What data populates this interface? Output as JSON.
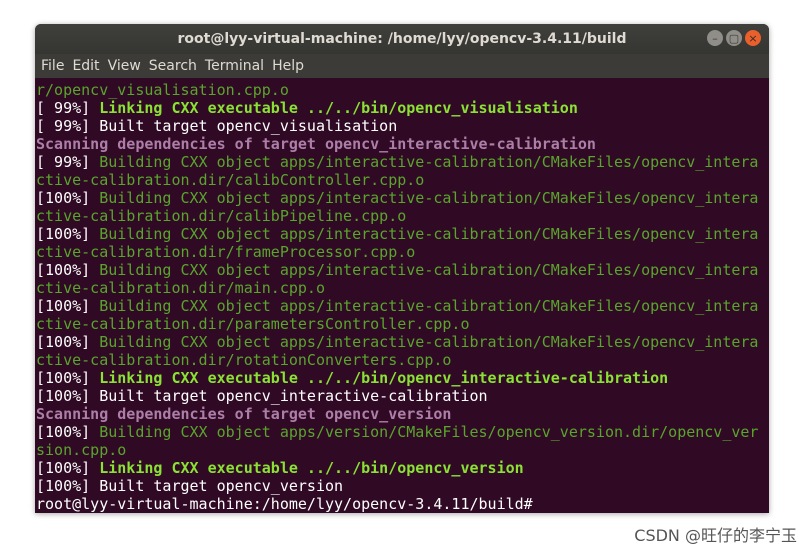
{
  "window": {
    "title": "root@lyy-virtual-machine: /home/lyy/opencv-3.4.11/build",
    "buttons": {
      "minimize": "–",
      "maximize": "▢",
      "close": "×"
    }
  },
  "menu": [
    "File",
    "Edit",
    "View",
    "Search",
    "Terminal",
    "Help"
  ],
  "terminal": {
    "lines": [
      {
        "prefix": "",
        "text": "r/opencv_visualisation.cpp.o",
        "style": "green"
      },
      {
        "prefix": "[ 99%] ",
        "text": "Linking CXX executable ../../bin/opencv_visualisation",
        "style": "bold-green"
      },
      {
        "prefix": "[ 99%] ",
        "text": "Built target opencv_visualisation",
        "style": "white"
      },
      {
        "prefix": "",
        "text": "Scanning dependencies of target opencv_interactive-calibration",
        "style": "magenta"
      },
      {
        "prefix": "[ 99%] ",
        "text": "Building CXX object apps/interactive-calibration/CMakeFiles/opencv_intera",
        "style": "green"
      },
      {
        "prefix": "",
        "text": "ctive-calibration.dir/calibController.cpp.o",
        "style": "green"
      },
      {
        "prefix": "[100%] ",
        "text": "Building CXX object apps/interactive-calibration/CMakeFiles/opencv_intera",
        "style": "green"
      },
      {
        "prefix": "",
        "text": "ctive-calibration.dir/calibPipeline.cpp.o",
        "style": "green"
      },
      {
        "prefix": "[100%] ",
        "text": "Building CXX object apps/interactive-calibration/CMakeFiles/opencv_intera",
        "style": "green"
      },
      {
        "prefix": "",
        "text": "ctive-calibration.dir/frameProcessor.cpp.o",
        "style": "green"
      },
      {
        "prefix": "[100%] ",
        "text": "Building CXX object apps/interactive-calibration/CMakeFiles/opencv_intera",
        "style": "green"
      },
      {
        "prefix": "",
        "text": "ctive-calibration.dir/main.cpp.o",
        "style": "green"
      },
      {
        "prefix": "[100%] ",
        "text": "Building CXX object apps/interactive-calibration/CMakeFiles/opencv_intera",
        "style": "green"
      },
      {
        "prefix": "",
        "text": "ctive-calibration.dir/parametersController.cpp.o",
        "style": "green"
      },
      {
        "prefix": "[100%] ",
        "text": "Building CXX object apps/interactive-calibration/CMakeFiles/opencv_intera",
        "style": "green"
      },
      {
        "prefix": "",
        "text": "ctive-calibration.dir/rotationConverters.cpp.o",
        "style": "green"
      },
      {
        "prefix": "[100%] ",
        "text": "Linking CXX executable ../../bin/opencv_interactive-calibration",
        "style": "bold-green"
      },
      {
        "prefix": "[100%] ",
        "text": "Built target opencv_interactive-calibration",
        "style": "white"
      },
      {
        "prefix": "",
        "text": "Scanning dependencies of target opencv_version",
        "style": "magenta"
      },
      {
        "prefix": "[100%] ",
        "text": "Building CXX object apps/version/CMakeFiles/opencv_version.dir/opencv_ver",
        "style": "green"
      },
      {
        "prefix": "",
        "text": "sion.cpp.o",
        "style": "green"
      },
      {
        "prefix": "[100%] ",
        "text": "Linking CXX executable ../../bin/opencv_version",
        "style": "bold-green"
      },
      {
        "prefix": "[100%] ",
        "text": "Built target opencv_version",
        "style": "white"
      }
    ],
    "prompt": "root@lyy-virtual-machine:/home/lyy/opencv-3.4.11/build#"
  },
  "watermark": "CSDN @旺仔的李宁玉",
  "colors": {
    "background": "#300a24",
    "green": "#59a52d",
    "bold_green": "#8ae234",
    "magenta": "#ad7fa8",
    "cursor": "#e9602c"
  }
}
